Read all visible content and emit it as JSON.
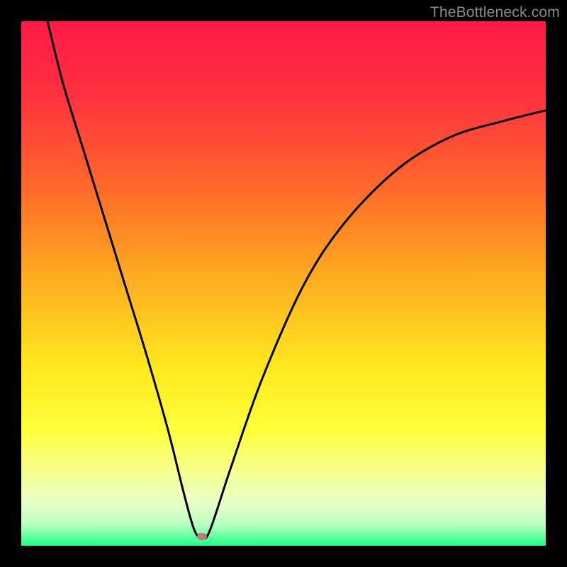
{
  "watermark": "TheBottleneck.com",
  "marker": {
    "x_pct": 34.5,
    "y_pct": 98.2
  },
  "chart_data": {
    "type": "line",
    "title": "",
    "xlabel": "",
    "ylabel": "",
    "xlim": [
      0,
      100
    ],
    "ylim": [
      0,
      100
    ],
    "grid": false,
    "legend": false,
    "gradient_stops": [
      {
        "pct": 0,
        "color": "#ff1a47"
      },
      {
        "pct": 14,
        "color": "#ff3040"
      },
      {
        "pct": 32,
        "color": "#ff6a2a"
      },
      {
        "pct": 50,
        "color": "#ffb020"
      },
      {
        "pct": 66,
        "color": "#ffe81e"
      },
      {
        "pct": 78,
        "color": "#ffff3a"
      },
      {
        "pct": 86,
        "color": "#f6ff90"
      },
      {
        "pct": 92,
        "color": "#e8ffc8"
      },
      {
        "pct": 96,
        "color": "#b8ffc0"
      },
      {
        "pct": 100,
        "color": "#20ff8a"
      }
    ],
    "series": [
      {
        "name": "bottleneck-curve",
        "color": "#000000",
        "x": [
          5,
          8,
          12,
          16,
          20,
          24,
          28,
          31,
          33,
          34.5,
          36,
          40,
          46,
          54,
          62,
          72,
          82,
          92,
          100
        ],
        "y": [
          100,
          88,
          75,
          62,
          49,
          36,
          22,
          10,
          3,
          1.5,
          3,
          15,
          32,
          50,
          62,
          72,
          78,
          81,
          83
        ]
      }
    ],
    "marker_point": {
      "x": 34.5,
      "y": 1.8
    },
    "notes": "y is plotted downward from top in the rendered image; values here are expressed with 0 at bottom (green) and 100 at top (red). Axes have no visible tick labels; values are estimated from geometry."
  }
}
